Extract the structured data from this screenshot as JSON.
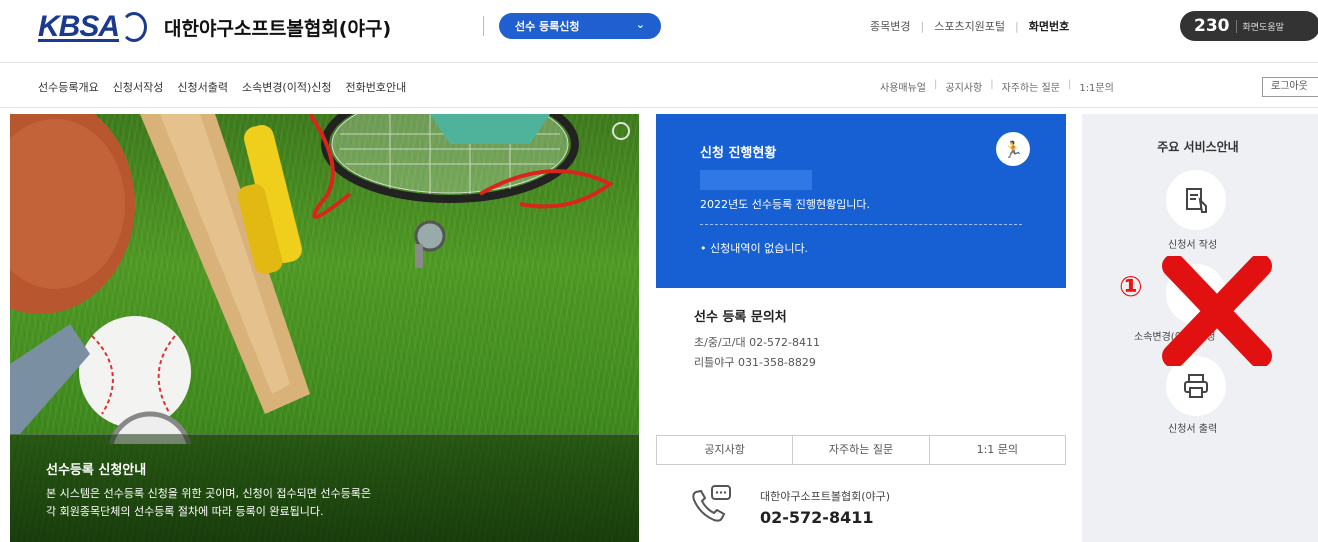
{
  "header": {
    "logo_text": "KBSA",
    "org_name": "대한야구소프트볼협회(야구)",
    "register_dropdown": "선수 등록신청",
    "top_links": [
      "종목변경",
      "스포츠지원포털"
    ],
    "remote_label": "화면번호",
    "remote_number": "230",
    "remote_help": "화면도움말"
  },
  "nav": {
    "menu": [
      "선수등록개요",
      "신청서작성",
      "신청서출력",
      "소속변경(이적)신청",
      "전화번호안내"
    ],
    "util_links": [
      "사용매뉴얼",
      "공지사항",
      "자주하는 질문",
      "1:1문의"
    ],
    "login": "로그아웃"
  },
  "hero": {
    "banner_title": "선수등록 신청안내",
    "banner_line1": "본 시스템은 선수등록 신청을 위한 곳이며, 신청이 접수되면 선수등록은",
    "banner_line2": "각 회원종목단체의 선수등록 절차에 따라 등록이 완료됩니다."
  },
  "progress": {
    "title": "신청 진행현황",
    "year_text": "2022년도 선수등록 진행현황입니다.",
    "none_text": "• 신청내역이 없습니다."
  },
  "contact": {
    "title": "선수 등록 문의처",
    "line1": "초/중/고/대  02-572-8411",
    "line2": "리틀야구  031-358-8829"
  },
  "tabs": [
    "공지사항",
    "자주하는 질문",
    "1:1 문의"
  ],
  "phone": {
    "org": "대한야구소프트볼협회(야구)",
    "number": "02-572-8411"
  },
  "services": {
    "title": "주요 서비스안내",
    "items": [
      {
        "label": "신청서 작성",
        "icon": "document-edit-icon"
      },
      {
        "label": "소속변경(이적)신청",
        "icon": "transfer-icon"
      },
      {
        "label": "신청서 출력",
        "icon": "printer-icon"
      }
    ],
    "annotation_number": "①"
  },
  "colors": {
    "brand_blue": "#1760d4",
    "logo_blue": "#1a3a8f",
    "annotation_red": "#e11111"
  }
}
